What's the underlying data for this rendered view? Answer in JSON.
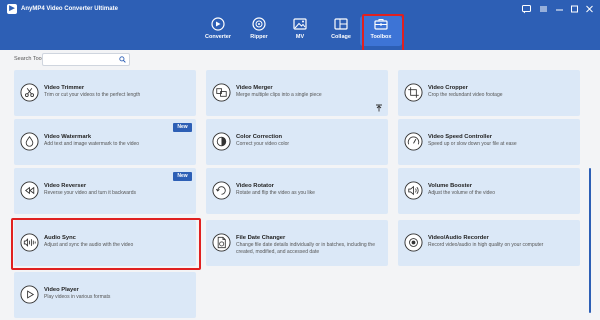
{
  "app": {
    "title": "AnyMP4 Video Converter Ultimate"
  },
  "nav": [
    {
      "key": "converter",
      "label": "Converter",
      "icon": "converter-icon"
    },
    {
      "key": "ripper",
      "label": "Ripper",
      "icon": "ripper-icon"
    },
    {
      "key": "mv",
      "label": "MV",
      "icon": "mv-icon"
    },
    {
      "key": "collage",
      "label": "Collage",
      "icon": "collage-icon"
    },
    {
      "key": "toolbox",
      "label": "Toolbox",
      "icon": "toolbox-icon",
      "selected": true
    }
  ],
  "search": {
    "label": "Search Tool:",
    "value": ""
  },
  "tools": [
    {
      "title": "Video Trimmer",
      "desc": "Trim or cut your videos to the perfect length",
      "icon": "trimmer-icon"
    },
    {
      "title": "Video Merger",
      "desc": "Merge multiple clips into a single piece",
      "icon": "merger-icon"
    },
    {
      "title": "Video Cropper",
      "desc": "Crop the redundant video footage",
      "icon": "cropper-icon"
    },
    {
      "title": "Video Watermark",
      "desc": "Add text and image watermark to the video",
      "icon": "watermark-icon",
      "badge": "New"
    },
    {
      "title": "Color Correction",
      "desc": "Correct your video color",
      "icon": "color-correction-icon"
    },
    {
      "title": "Video Speed Controller",
      "desc": "Speed up or slow down your file at ease",
      "icon": "speed-icon"
    },
    {
      "title": "Video Reverser",
      "desc": "Reverse your video and turn it backwards",
      "icon": "reverser-icon",
      "badge": "New"
    },
    {
      "title": "Video Rotator",
      "desc": "Rotate and flip the video as you like",
      "icon": "rotator-icon"
    },
    {
      "title": "Volume Booster",
      "desc": "Adjust the volume of the video",
      "icon": "volume-icon"
    },
    {
      "title": "Audio Sync",
      "desc": "Adjust and sync the audio with the video",
      "icon": "audio-sync-icon",
      "highlighted": true
    },
    {
      "title": "File Date Changer",
      "desc": "Change file date details individually or in batches, including the created, modified, and accessed date",
      "icon": "file-date-icon"
    },
    {
      "title": "Video/Audio Recorder",
      "desc": "Record video/audio in high quality on your computer",
      "icon": "recorder-icon"
    },
    {
      "title": "Video Player",
      "desc": "Play videos in various formats",
      "icon": "player-icon"
    }
  ],
  "colors": {
    "header": "#2d5fb5",
    "card": "#dbe8f7",
    "highlight": "#e02020"
  }
}
